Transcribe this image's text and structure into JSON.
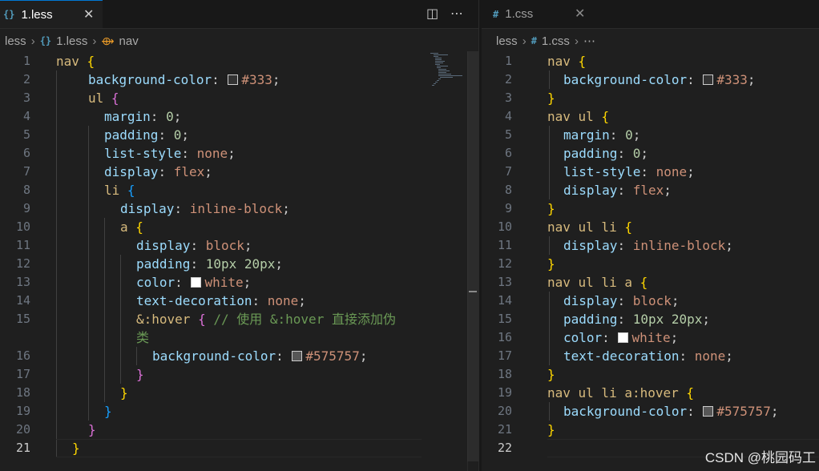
{
  "left": {
    "tab": {
      "icon": "{}",
      "label": "1.less",
      "close": "✕"
    },
    "actions": {
      "split": "◫",
      "more": "⋯"
    },
    "breadcrumb": {
      "folder": "less",
      "file_icon": "{}",
      "file": "1.less",
      "symbol": "nav"
    }
  },
  "right": {
    "tab": {
      "icon": "#",
      "label": "1.css",
      "close": "✕"
    },
    "breadcrumb": {
      "folder": "less",
      "file_icon": "#",
      "file": "1.css",
      "more": "⋯"
    }
  },
  "less_lines": [
    {
      "n": "1",
      "tokens": [
        [
          "sel",
          "nav"
        ],
        [
          "p",
          " "
        ],
        [
          "b1",
          "{"
        ]
      ]
    },
    {
      "n": "2",
      "tokens": [
        [
          "prop",
          "background-color"
        ],
        [
          "p",
          ": "
        ],
        [
          "sw",
          "#333333"
        ],
        [
          "val",
          "#333"
        ],
        [
          "p",
          ";"
        ]
      ]
    },
    {
      "n": "3",
      "tokens": [
        [
          "sel",
          "ul"
        ],
        [
          "p",
          " "
        ],
        [
          "b2",
          "{"
        ]
      ]
    },
    {
      "n": "4",
      "tokens": [
        [
          "prop",
          "margin"
        ],
        [
          "p",
          ": "
        ],
        [
          "num",
          "0"
        ],
        [
          "p",
          ";"
        ]
      ]
    },
    {
      "n": "5",
      "tokens": [
        [
          "prop",
          "padding"
        ],
        [
          "p",
          ": "
        ],
        [
          "num",
          "0"
        ],
        [
          "p",
          ";"
        ]
      ]
    },
    {
      "n": "6",
      "tokens": [
        [
          "prop",
          "list-style"
        ],
        [
          "p",
          ": "
        ],
        [
          "val",
          "none"
        ],
        [
          "p",
          ";"
        ]
      ]
    },
    {
      "n": "7",
      "tokens": [
        [
          "prop",
          "display"
        ],
        [
          "p",
          ": "
        ],
        [
          "val",
          "flex"
        ],
        [
          "p",
          ";"
        ]
      ]
    },
    {
      "n": "8",
      "tokens": [
        [
          "sel",
          "li"
        ],
        [
          "p",
          " "
        ],
        [
          "b3",
          "{"
        ]
      ]
    },
    {
      "n": "9",
      "tokens": [
        [
          "prop",
          "display"
        ],
        [
          "p",
          ": "
        ],
        [
          "val",
          "inline-block"
        ],
        [
          "p",
          ";"
        ]
      ]
    },
    {
      "n": "10",
      "tokens": [
        [
          "sel",
          "a"
        ],
        [
          "p",
          " "
        ],
        [
          "b1",
          "{"
        ]
      ]
    },
    {
      "n": "11",
      "tokens": [
        [
          "prop",
          "display"
        ],
        [
          "p",
          ": "
        ],
        [
          "val",
          "block"
        ],
        [
          "p",
          ";"
        ]
      ]
    },
    {
      "n": "12",
      "tokens": [
        [
          "prop",
          "padding"
        ],
        [
          "p",
          ": "
        ],
        [
          "num",
          "10px 20px"
        ],
        [
          "p",
          ";"
        ]
      ]
    },
    {
      "n": "13",
      "tokens": [
        [
          "prop",
          "color"
        ],
        [
          "p",
          ": "
        ],
        [
          "sw",
          "#ffffff"
        ],
        [
          "val",
          "white"
        ],
        [
          "p",
          ";"
        ]
      ]
    },
    {
      "n": "14",
      "tokens": [
        [
          "prop",
          "text-decoration"
        ],
        [
          "p",
          ": "
        ],
        [
          "val",
          "none"
        ],
        [
          "p",
          ";"
        ]
      ]
    },
    {
      "n": "15",
      "tokens": [
        [
          "sel",
          "&:hover"
        ],
        [
          "p",
          " "
        ],
        [
          "b2",
          "{"
        ],
        [
          "p",
          " "
        ],
        [
          "com",
          "// 使用 &:hover 直接添加伪"
        ]
      ]
    },
    {
      "n": "",
      "tokens": [
        [
          "com",
          "类"
        ]
      ]
    },
    {
      "n": "16",
      "tokens": [
        [
          "prop",
          "background-color"
        ],
        [
          "p",
          ": "
        ],
        [
          "sw",
          "#575757"
        ],
        [
          "val",
          "#575757"
        ],
        [
          "p",
          ";"
        ]
      ]
    },
    {
      "n": "17",
      "tokens": [
        [
          "b2",
          "}"
        ]
      ]
    },
    {
      "n": "18",
      "tokens": [
        [
          "b1",
          "}"
        ]
      ]
    },
    {
      "n": "19",
      "tokens": [
        [
          "b3",
          "}"
        ]
      ]
    },
    {
      "n": "20",
      "tokens": [
        [
          "b2",
          "}"
        ]
      ]
    },
    {
      "n": "21",
      "tokens": [
        [
          "b1",
          "}"
        ]
      ]
    }
  ],
  "css_lines": [
    {
      "n": "1",
      "tokens": [
        [
          "sel",
          "nav"
        ],
        [
          "p",
          " "
        ],
        [
          "b1",
          "{"
        ]
      ]
    },
    {
      "n": "2",
      "tokens": [
        [
          "prop",
          "background-color"
        ],
        [
          "p",
          ": "
        ],
        [
          "sw",
          "#333333"
        ],
        [
          "val",
          "#333"
        ],
        [
          "p",
          ";"
        ]
      ]
    },
    {
      "n": "3",
      "tokens": [
        [
          "b1",
          "}"
        ]
      ]
    },
    {
      "n": "4",
      "tokens": [
        [
          "sel",
          "nav ul"
        ],
        [
          "p",
          " "
        ],
        [
          "b1",
          "{"
        ]
      ]
    },
    {
      "n": "5",
      "tokens": [
        [
          "prop",
          "margin"
        ],
        [
          "p",
          ": "
        ],
        [
          "num",
          "0"
        ],
        [
          "p",
          ";"
        ]
      ]
    },
    {
      "n": "6",
      "tokens": [
        [
          "prop",
          "padding"
        ],
        [
          "p",
          ": "
        ],
        [
          "num",
          "0"
        ],
        [
          "p",
          ";"
        ]
      ]
    },
    {
      "n": "7",
      "tokens": [
        [
          "prop",
          "list-style"
        ],
        [
          "p",
          ": "
        ],
        [
          "val",
          "none"
        ],
        [
          "p",
          ";"
        ]
      ]
    },
    {
      "n": "8",
      "tokens": [
        [
          "prop",
          "display"
        ],
        [
          "p",
          ": "
        ],
        [
          "val",
          "flex"
        ],
        [
          "p",
          ";"
        ]
      ]
    },
    {
      "n": "9",
      "tokens": [
        [
          "b1",
          "}"
        ]
      ]
    },
    {
      "n": "10",
      "tokens": [
        [
          "sel",
          "nav ul li"
        ],
        [
          "p",
          " "
        ],
        [
          "b1",
          "{"
        ]
      ]
    },
    {
      "n": "11",
      "tokens": [
        [
          "prop",
          "display"
        ],
        [
          "p",
          ": "
        ],
        [
          "val",
          "inline-block"
        ],
        [
          "p",
          ";"
        ]
      ]
    },
    {
      "n": "12",
      "tokens": [
        [
          "b1",
          "}"
        ]
      ]
    },
    {
      "n": "13",
      "tokens": [
        [
          "sel",
          "nav ul li a"
        ],
        [
          "p",
          " "
        ],
        [
          "b1",
          "{"
        ]
      ]
    },
    {
      "n": "14",
      "tokens": [
        [
          "prop",
          "display"
        ],
        [
          "p",
          ": "
        ],
        [
          "val",
          "block"
        ],
        [
          "p",
          ";"
        ]
      ]
    },
    {
      "n": "15",
      "tokens": [
        [
          "prop",
          "padding"
        ],
        [
          "p",
          ": "
        ],
        [
          "num",
          "10px 20px"
        ],
        [
          "p",
          ";"
        ]
      ]
    },
    {
      "n": "16",
      "tokens": [
        [
          "prop",
          "color"
        ],
        [
          "p",
          ": "
        ],
        [
          "sw",
          "#ffffff"
        ],
        [
          "val",
          "white"
        ],
        [
          "p",
          ";"
        ]
      ]
    },
    {
      "n": "17",
      "tokens": [
        [
          "prop",
          "text-decoration"
        ],
        [
          "p",
          ": "
        ],
        [
          "val",
          "none"
        ],
        [
          "p",
          ";"
        ]
      ]
    },
    {
      "n": "18",
      "tokens": [
        [
          "b1",
          "}"
        ]
      ]
    },
    {
      "n": "19",
      "tokens": [
        [
          "sel",
          "nav ul li a:hover"
        ],
        [
          "p",
          " "
        ],
        [
          "b1",
          "{"
        ]
      ]
    },
    {
      "n": "20",
      "tokens": [
        [
          "prop",
          "background-color"
        ],
        [
          "p",
          ": "
        ],
        [
          "sw",
          "#575757"
        ],
        [
          "val",
          "#575757"
        ],
        [
          "p",
          ";"
        ]
      ]
    },
    {
      "n": "21",
      "tokens": [
        [
          "b1",
          "}"
        ]
      ]
    },
    {
      "n": "22",
      "tokens": []
    }
  ],
  "watermark": "CSDN @桃园码工"
}
